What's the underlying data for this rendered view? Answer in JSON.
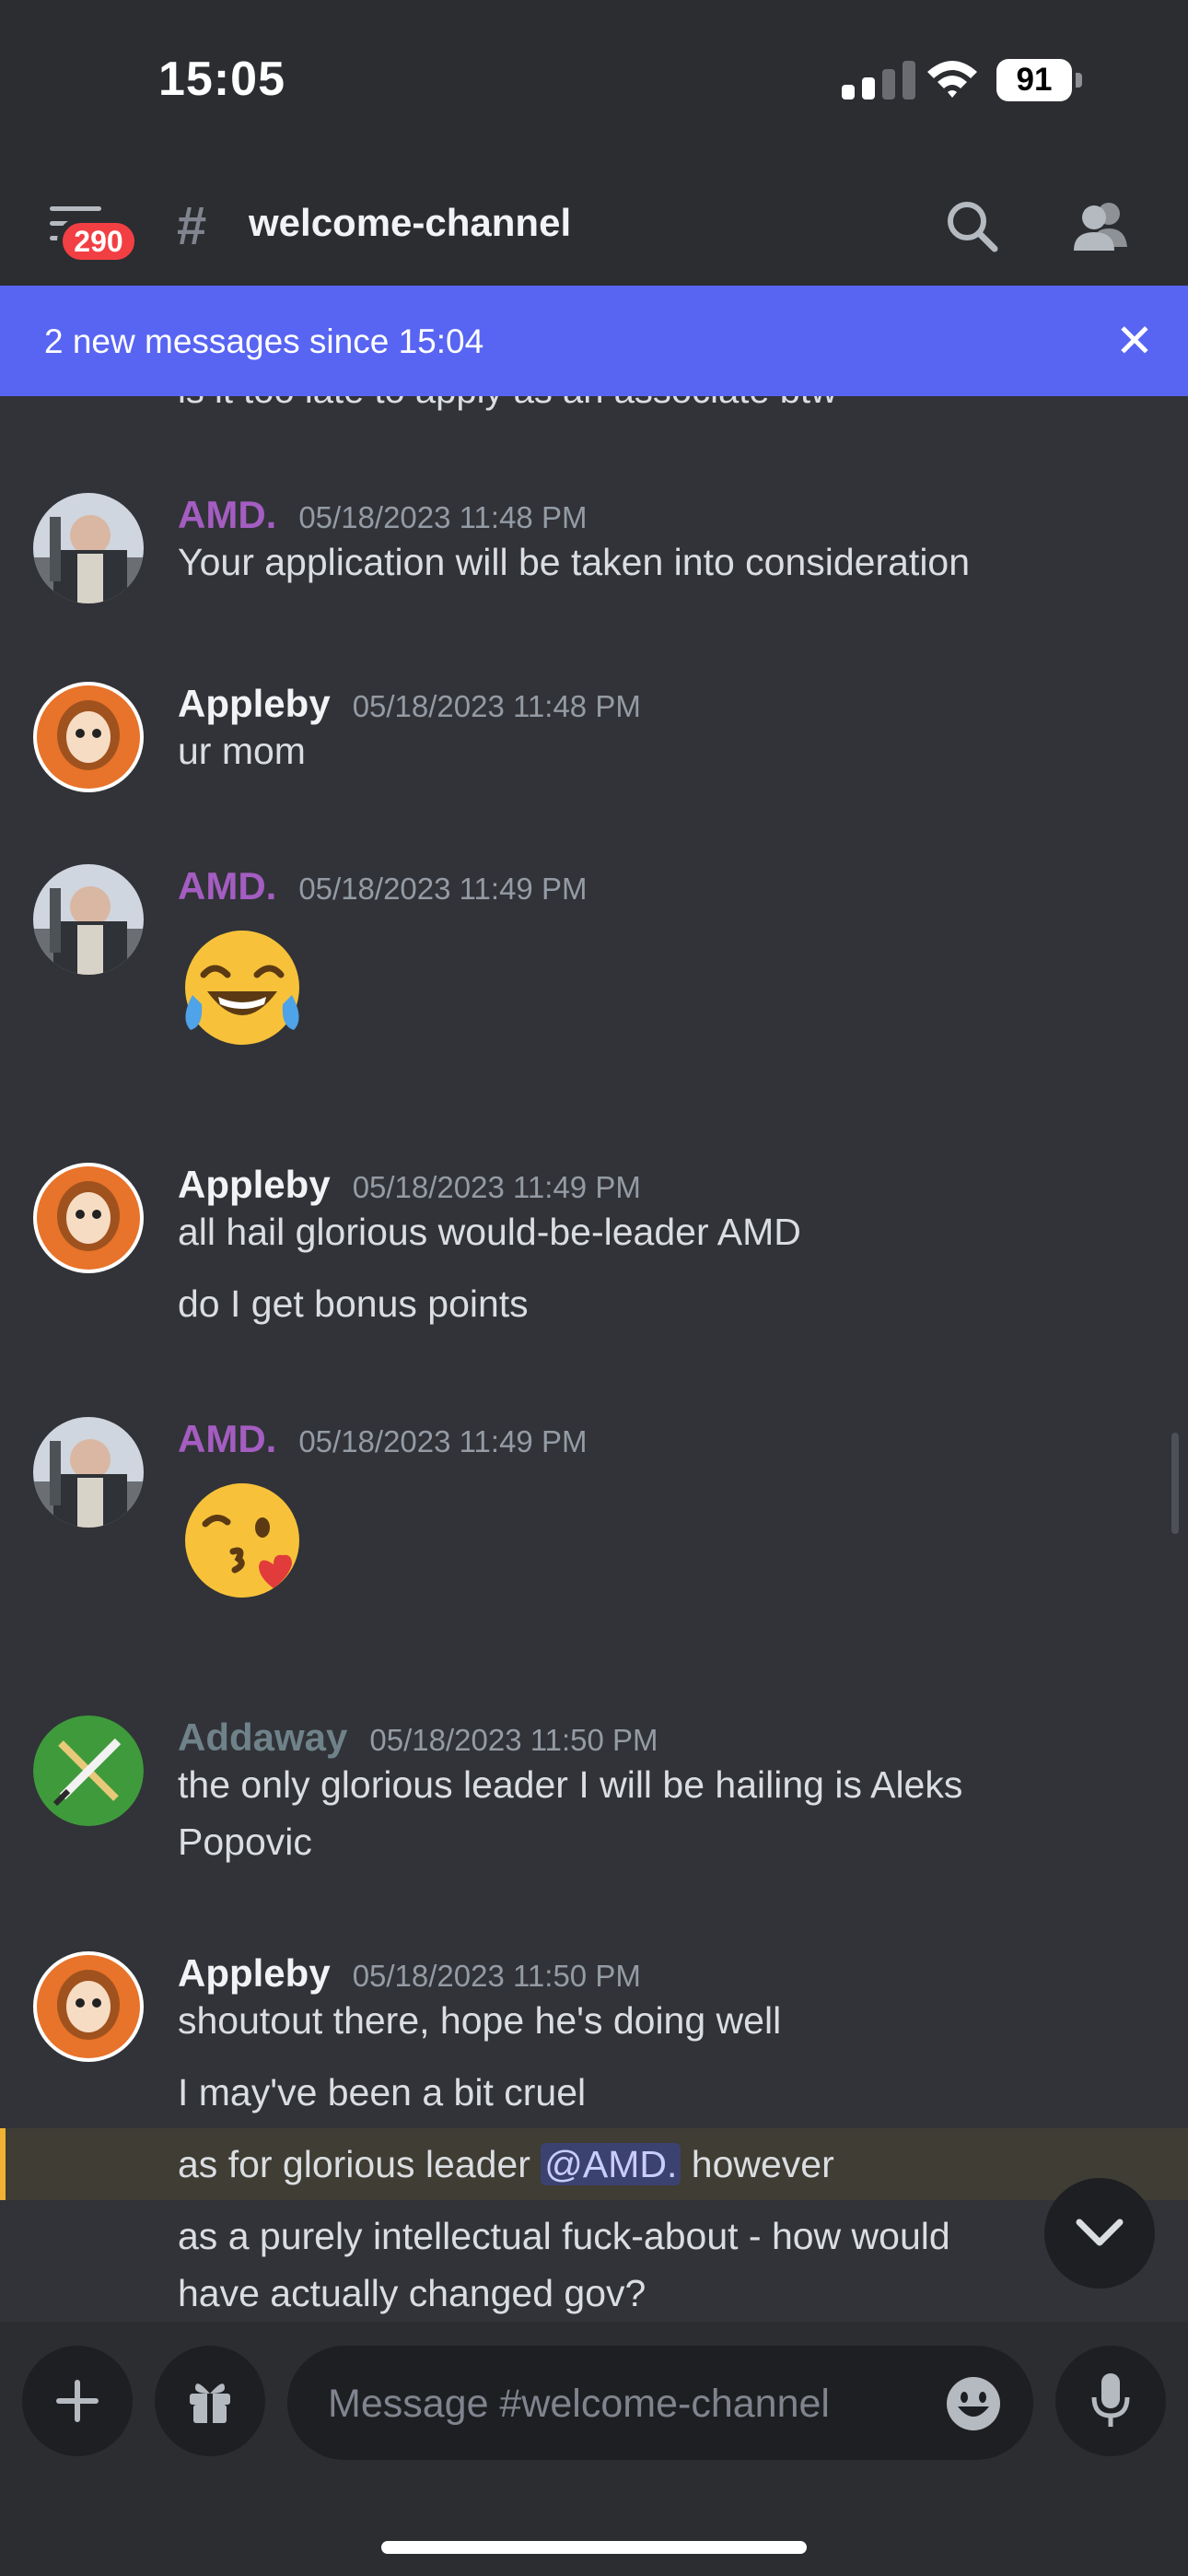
{
  "status_bar": {
    "time": "15:05",
    "battery": "91"
  },
  "header": {
    "unread_count": "290",
    "channel_name": "welcome-channel"
  },
  "banner": {
    "text": "2 new messages since 15:04"
  },
  "chat": {
    "partial_top_line": "is it too late to apply as an associate btw",
    "messages": [
      {
        "author": "AMD.",
        "time": "05/18/2023 11:48 PM",
        "lines": [
          "Your application will be taken into consideration"
        ]
      },
      {
        "author": "Appleby",
        "time": "05/18/2023 11:48 PM",
        "lines": [
          "ur mom"
        ]
      },
      {
        "author": "AMD.",
        "time": "05/18/2023 11:49 PM",
        "emoji": "face-with-tears-of-joy"
      },
      {
        "author": "Appleby",
        "time": "05/18/2023 11:49 PM",
        "lines": [
          "all hail glorious would-be-leader AMD",
          "do I get bonus points"
        ]
      },
      {
        "author": "AMD.",
        "time": "05/18/2023 11:49 PM",
        "emoji": "face-blowing-a-kiss"
      },
      {
        "author": "Addaway",
        "time": "05/18/2023 11:50 PM",
        "lines": [
          "the only glorious leader I will be hailing is Aleks",
          "Popovic"
        ]
      },
      {
        "author": "Appleby",
        "time": "05/18/2023 11:50 PM",
        "lines": [
          "shoutout there, hope he's doing well",
          "I may've been a bit cruel",
          "as for glorious leader ",
          "as a purely intellectual fuck-about - how would",
          "have actually changed gov?"
        ],
        "mention": "@AMD.",
        "mention_tail": " however"
      }
    ]
  },
  "composer": {
    "placeholder": "Message #welcome-channel"
  },
  "colors": {
    "background": "#313338",
    "header": "#2b2d31",
    "banner": "#5865f2",
    "amd_name": "#a45dc1",
    "appleby_name": "#f2f3f5",
    "addaway_name": "#6f8289",
    "highlight": "#3f3d34",
    "mention_bar": "#f0b232",
    "badge": "#f23f43"
  },
  "icons": [
    "cellular-signal-icon",
    "wifi-icon",
    "battery-icon",
    "menu-icon",
    "hash-icon",
    "search-icon",
    "members-icon",
    "close-icon",
    "chevron-down-icon",
    "plus-icon",
    "gift-icon",
    "emoji-icon",
    "microphone-icon"
  ]
}
